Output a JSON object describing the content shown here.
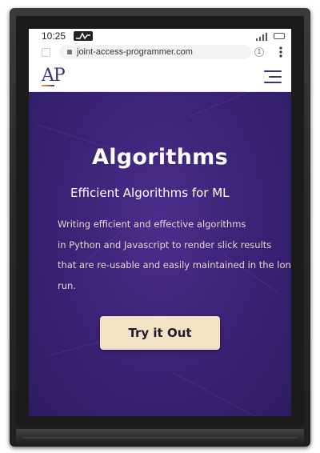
{
  "status_bar": {
    "time": "10:25",
    "notification_icon": "pulse-icon",
    "signal_icon": "signal-icon",
    "battery_icon": "battery-icon"
  },
  "browser": {
    "url": "joint-access-programmer.com",
    "tab_count": "1",
    "lock_icon": "lock-icon",
    "menu_icon": "kebab-menu-icon"
  },
  "site": {
    "logo_text": "AP",
    "menu_icon": "hamburger-menu-icon",
    "brand_color": "#3b2f7a"
  },
  "hero": {
    "title": "Algorithms",
    "subtitle": "Efficient Algorithms for  ML",
    "body_lines": [
      "Writing efficient and effective algorithms",
      "in Python and Javascript to render slick results",
      "that are re-usable and easily maintained in the long-",
      "run."
    ],
    "cta_label": "Try it Out",
    "background_color": "#3c2478",
    "cta_color": "#f3e2c3",
    "text_color": "#e6d7c9"
  }
}
